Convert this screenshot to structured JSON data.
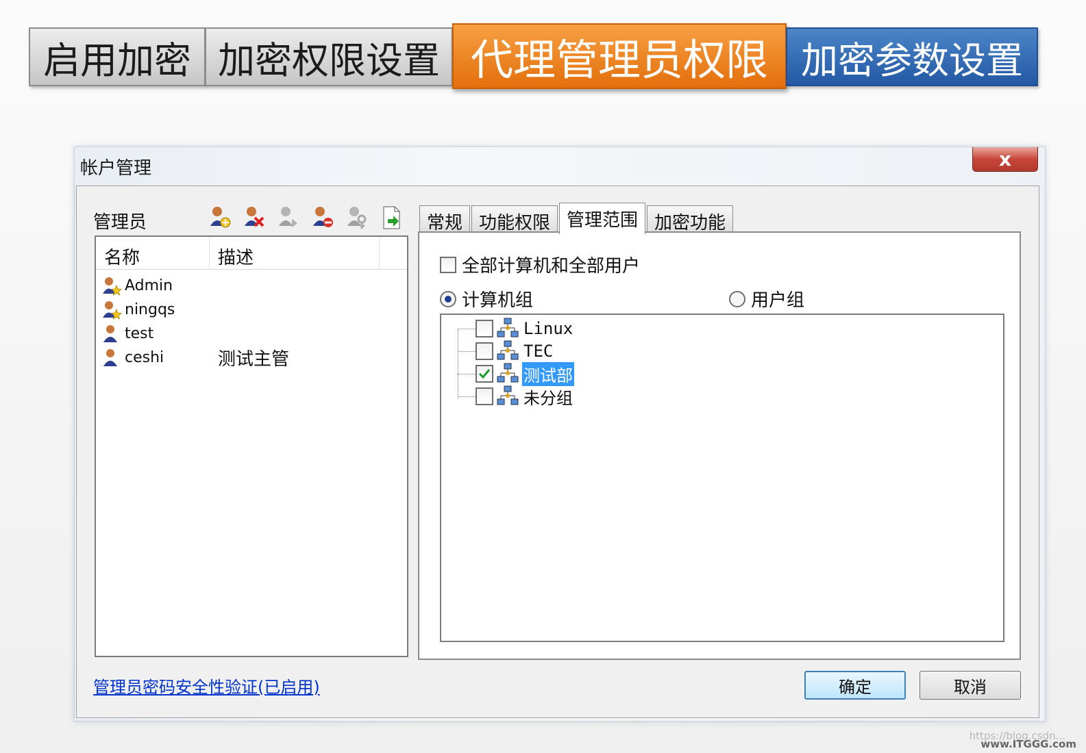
{
  "slide_tabs": [
    {
      "label": "启用加密"
    },
    {
      "label": "加密权限设置"
    },
    {
      "label": "代理管理员权限"
    },
    {
      "label": "加密参数设置"
    }
  ],
  "dialog": {
    "title": "帐户管理",
    "close_label": "x"
  },
  "admins": {
    "label": "管理员",
    "toolbar_icons": [
      "add-admin-icon",
      "delete-admin-icon",
      "admin-properties-icon",
      "disable-admin-icon",
      "admin-key-icon",
      "export-icon"
    ],
    "columns": {
      "name": "名称",
      "desc": "描述"
    },
    "rows": [
      {
        "name": "Admin",
        "desc": "",
        "icon": "admin-star-icon"
      },
      {
        "name": "ningqs",
        "desc": "",
        "icon": "admin-star-icon"
      },
      {
        "name": "test",
        "desc": "",
        "icon": "user-icon"
      },
      {
        "name": "ceshi",
        "desc": "测试主管",
        "icon": "user-icon"
      }
    ],
    "password_link": "管理员密码安全性验证(已启用)"
  },
  "tabs": [
    "常规",
    "功能权限",
    "管理范围",
    "加密功能"
  ],
  "active_tab": "管理范围",
  "scope": {
    "all_label": "全部计算机和全部用户",
    "all_checked": false,
    "radio_computer": "计算机组",
    "radio_user": "用户组",
    "selected_radio": "计算机组",
    "tree": [
      {
        "label": "Linux",
        "checked": false,
        "selected": false
      },
      {
        "label": "TEC",
        "checked": false,
        "selected": false
      },
      {
        "label": "测试部",
        "checked": true,
        "selected": true
      },
      {
        "label": "未分组",
        "checked": false,
        "selected": false
      }
    ]
  },
  "buttons": {
    "ok": "确定",
    "cancel": "取消"
  },
  "watermark": "https://blog.csdn...",
  "watermark_site": "www.ITGGG.com",
  "colors": {
    "active_tab": "#e97a12",
    "blue_tab": "#2f63ad",
    "selection": "#3399ff"
  }
}
